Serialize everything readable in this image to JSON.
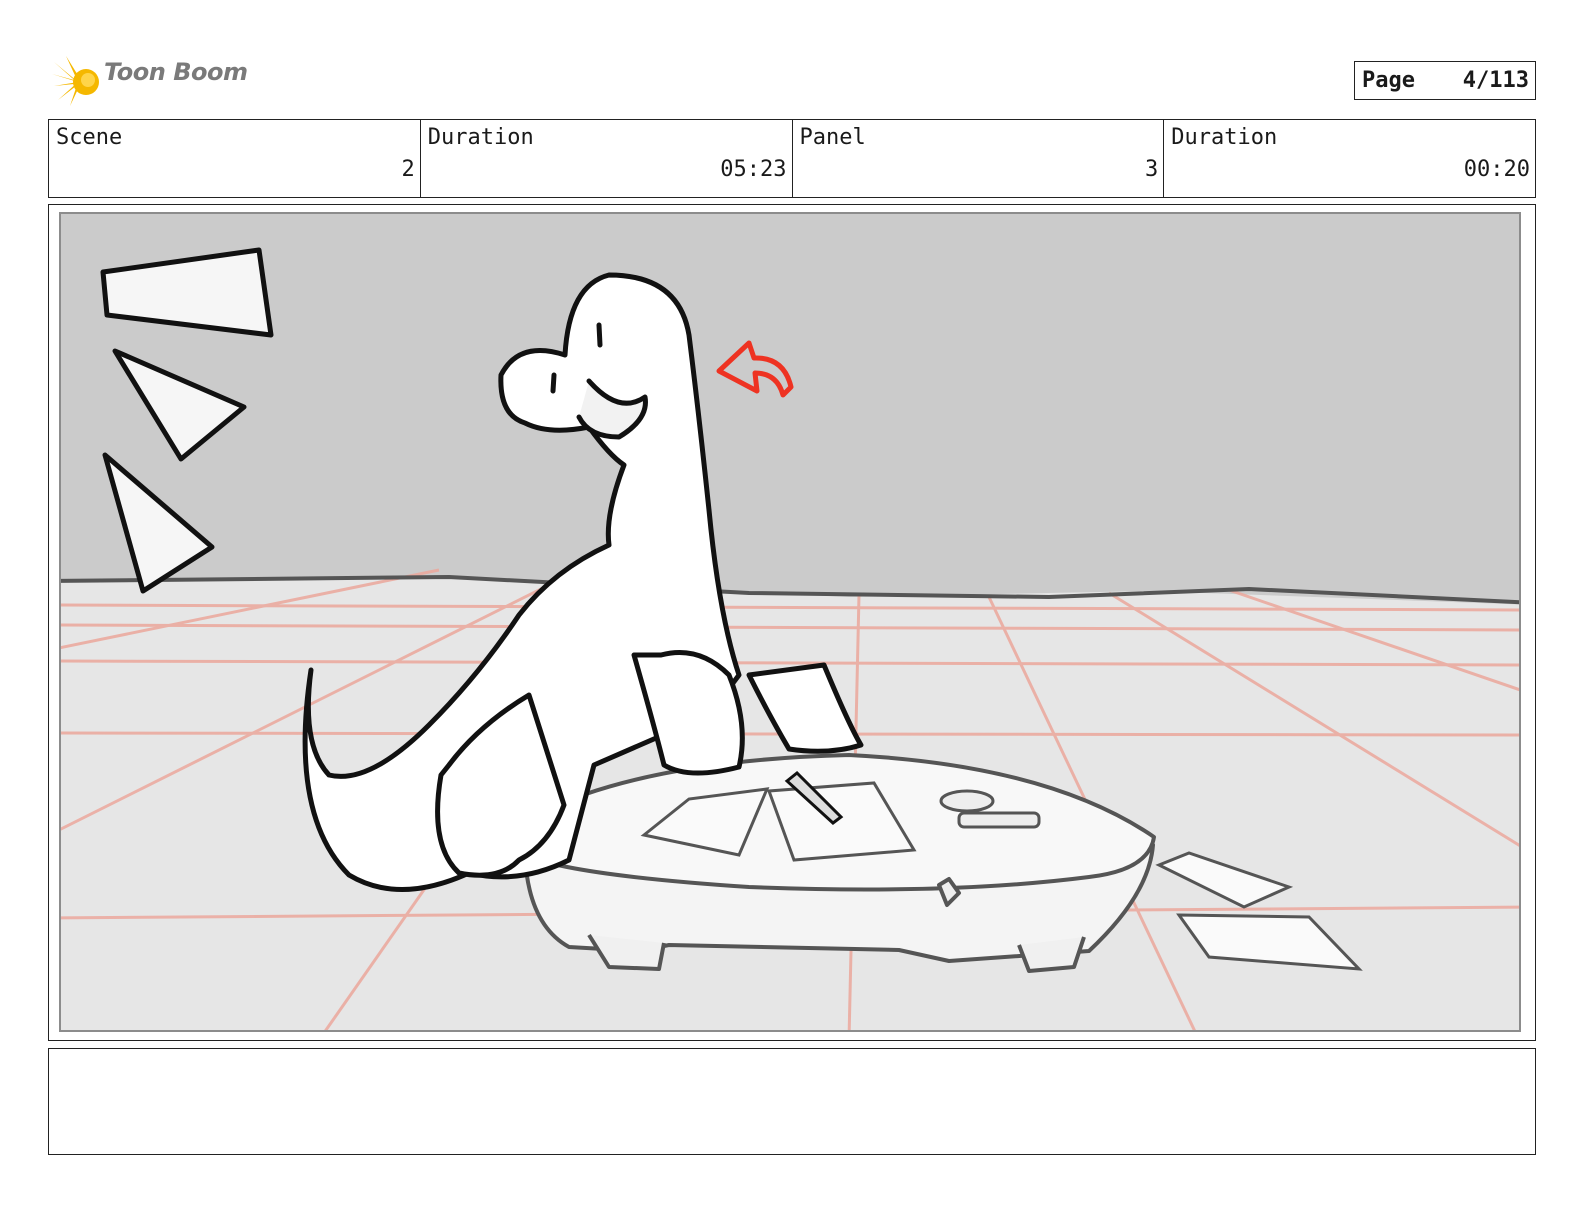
{
  "header": {
    "logo_text": "Toon Boom",
    "page_label": "Page",
    "page_value": "4/113"
  },
  "info": {
    "scene_label": "Scene",
    "scene_value": "2",
    "scene_duration_label": "Duration",
    "scene_duration_value": "05:23",
    "panel_label": "Panel",
    "panel_value": "3",
    "panel_duration_label": "Duration",
    "panel_duration_value": "00:20"
  },
  "notes": {
    "text": ""
  },
  "colors": {
    "wall": "#cbcbcb",
    "floor": "#e6e6e6",
    "floor_grid": "#eba79c",
    "arrow": "#ee3322",
    "logo_burst": "#f5b800"
  }
}
